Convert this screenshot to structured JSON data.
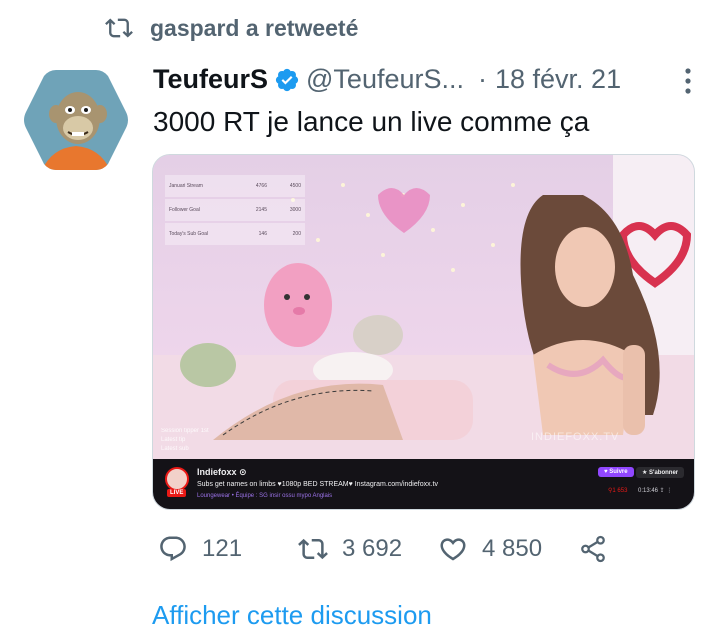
{
  "retweet_context": {
    "label": "gaspard a retweeté",
    "icon": "retweet-icon"
  },
  "tweet": {
    "author_name": "TeufeurS",
    "handle": "@TeufeurS...",
    "separator": "·",
    "date": "18 févr. 21",
    "text": "3000 RT je lance un live comme ça",
    "verified_color": "#1d9bf0"
  },
  "media": {
    "goal_overlay": [
      {
        "label": "Januari Stream",
        "current": "4766",
        "goal": "4500"
      },
      {
        "label": "Follower Goal",
        "current": "2145",
        "goal": "3000"
      },
      {
        "label": "Today's Sub Goal",
        "current": "146",
        "goal": "200"
      }
    ],
    "overlay_text": [
      "Session tipper 1st",
      "Latest tip",
      "Latest sub"
    ],
    "watermark": "INDIEFOXX.TV",
    "stream_bar": {
      "streamer": "Indiefoxx ⊙",
      "title": "Subs get names on limbs ♥1080p BED STREAM♥ Instagram.com/indiefoxx.tv",
      "meta": "Loungewear  •  Équipe : SG   insir ossu mypo   Anglais",
      "live_label": "LIVE",
      "follow_label": "♥ Suivre",
      "subscribe_label": "★ S'abonner",
      "viewers": "⚲1 653",
      "uptime": "0:13:46  ⇪  ⋮"
    }
  },
  "actions": {
    "replies": "121",
    "retweets": "3 692",
    "likes": "4 850"
  },
  "show_thread": "Afficher cette discussion",
  "colors": {
    "secondary": "#536471",
    "link": "#1d9bf0",
    "text": "#0f1419"
  }
}
